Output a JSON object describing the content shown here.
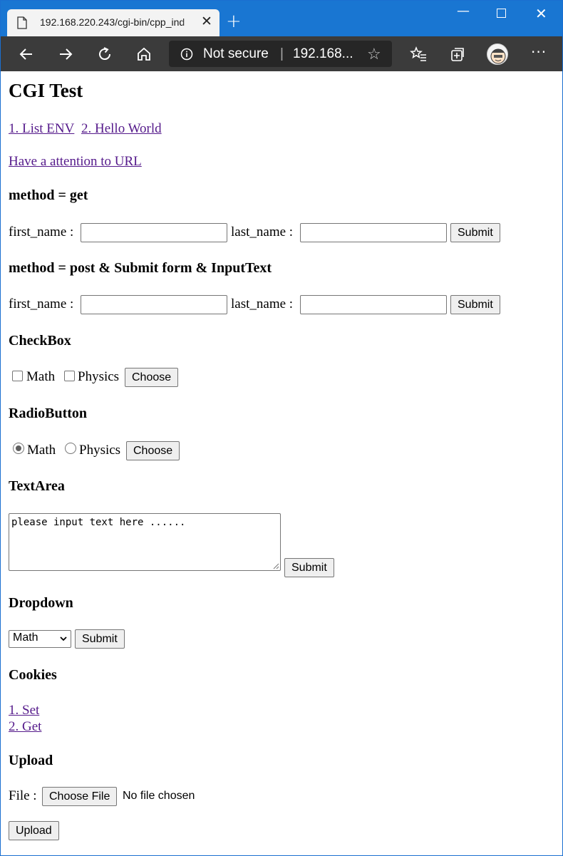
{
  "browser": {
    "tab_title": "192.168.220.243/cgi-bin/cpp_ind",
    "address_security": "Not secure",
    "address_url": "192.168...",
    "accent_color": "#1976d2"
  },
  "page": {
    "title": "CGI Test",
    "links": {
      "list_env": "1. List ENV",
      "hello_world": "2. Hello World",
      "attention": "Have a attention to URL"
    },
    "get_form": {
      "heading": "method = get",
      "first_label": "first_name :",
      "last_label": "last_name :",
      "first_value": "",
      "last_value": "",
      "submit": "Submit"
    },
    "post_form": {
      "heading": "method = post & Submit form & InputText",
      "first_label": "first_name :",
      "last_label": "last_name :",
      "first_value": "",
      "last_value": "",
      "submit": "Submit"
    },
    "checkbox": {
      "heading": "CheckBox",
      "option1": "Math",
      "option2": "Physics",
      "option1_checked": false,
      "option2_checked": false,
      "button": "Choose"
    },
    "radio": {
      "heading": "RadioButton",
      "option1": "Math",
      "option2": "Physics",
      "selected": "Math",
      "button": "Choose"
    },
    "textarea": {
      "heading": "TextArea",
      "value": "please input text here ......",
      "submit": "Submit"
    },
    "dropdown": {
      "heading": "Dropdown",
      "selected": "Math",
      "submit": "Submit"
    },
    "cookies": {
      "heading": "Cookies",
      "set": "1. Set",
      "get": "2. Get"
    },
    "upload": {
      "heading": "Upload",
      "file_label": "File :",
      "choose_button": "Choose File",
      "no_file": "No file chosen",
      "upload_button": "Upload"
    }
  }
}
